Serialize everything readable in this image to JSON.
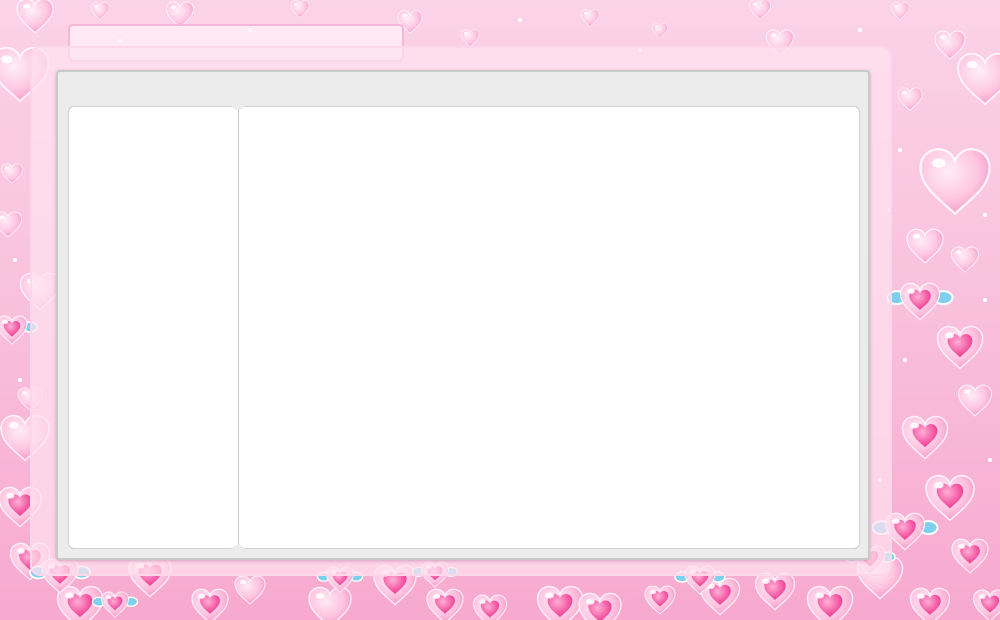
{
  "window": {
    "title": ""
  },
  "sidebar": {
    "content": ""
  },
  "main": {
    "content": ""
  },
  "theme": {
    "accent": "#f7a9cf",
    "heart_pink": "#ff5fa8",
    "heart_light": "#ffc7e2",
    "wing_blue": "#7fd0ee",
    "panel_bg": "#ececec",
    "content_bg": "#ffffff"
  },
  "decoration": {
    "icon": "heart-icon",
    "wing_icon": "wing-icon"
  }
}
